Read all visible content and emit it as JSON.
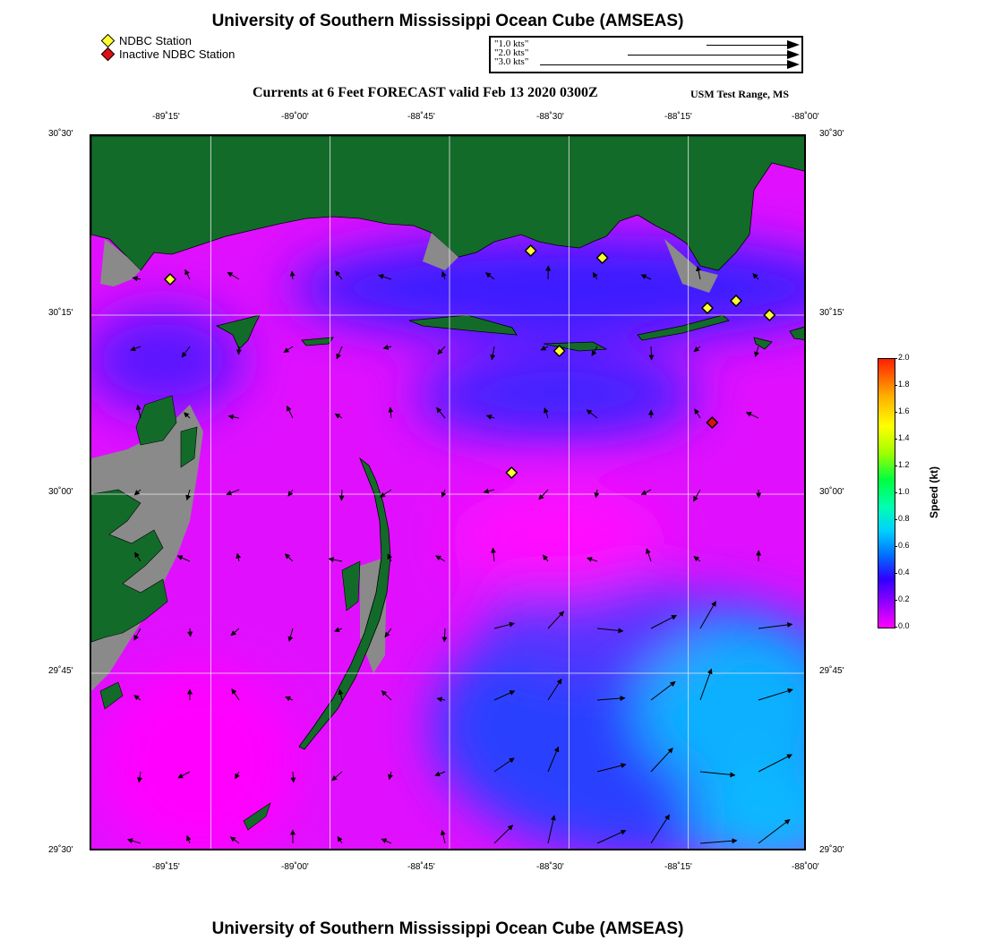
{
  "title": "University of Southern Mississippi Ocean Cube (AMSEAS)",
  "footer_title": "University of Southern Mississippi Ocean Cube (AMSEAS)",
  "legend": {
    "active_label": "NDBC Station",
    "inactive_label": "Inactive NDBC Station",
    "active_color": "#ffff33",
    "inactive_color": "#dd1111"
  },
  "scale_arrows": [
    {
      "label": "1.0 kts",
      "speed": 1.0
    },
    {
      "label": "2.0 kts",
      "speed": 2.0
    },
    {
      "label": "3.0 kts",
      "speed": 3.0
    }
  ],
  "subtitle": "Currents at 6 Feet FORECAST valid Feb 13 2020 0300Z",
  "region": "USM Test Range, MS",
  "axes": {
    "lon_labels": [
      "-89˚15'",
      "-89˚00'",
      "-88˚45'",
      "-88˚30'",
      "-88˚15'",
      "-88˚00'"
    ],
    "lat_labels": [
      "30˚30'",
      "30˚15'",
      "30˚00'",
      "29˚45'",
      "29˚30'"
    ]
  },
  "colorbar": {
    "label": "Speed (kt)",
    "ticks": [
      "2.0",
      "1.8",
      "1.6",
      "1.4",
      "1.2",
      "1.0",
      "0.8",
      "0.6",
      "0.4",
      "0.2",
      "0.0"
    ]
  },
  "colors": {
    "land": "#136b2a",
    "marsh": "#8a8a8a",
    "low_speed": "#ff00ff",
    "mid_speed": "#3020ff",
    "high_speed": "#00c8ff"
  },
  "stations": [
    {
      "name": "ndbc-1",
      "lon": -89.335,
      "lat": 30.3,
      "active": true
    },
    {
      "name": "ndbc-2",
      "lon": -88.58,
      "lat": 30.34,
      "active": true
    },
    {
      "name": "ndbc-3",
      "lon": -88.43,
      "lat": 30.33,
      "active": true
    },
    {
      "name": "ndbc-4",
      "lon": -88.15,
      "lat": 30.27,
      "active": true
    },
    {
      "name": "ndbc-5",
      "lon": -88.21,
      "lat": 30.26,
      "active": true
    },
    {
      "name": "ndbc-6",
      "lon": -88.08,
      "lat": 30.25,
      "active": true
    },
    {
      "name": "ndbc-7",
      "lon": -88.52,
      "lat": 30.2,
      "active": true
    },
    {
      "name": "ndbc-8",
      "lon": -88.62,
      "lat": 30.03,
      "active": true
    },
    {
      "name": "ndbc-9",
      "lon": -88.2,
      "lat": 30.1,
      "active": false
    }
  ]
}
